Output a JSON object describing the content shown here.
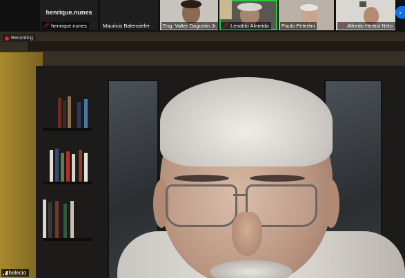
{
  "participants": [
    {
      "id": "henrique",
      "display": "henrique.nunes",
      "label": "henrique.nunes",
      "muted": true
    },
    {
      "id": "mauricio",
      "label": "Mauricio Balensiefer",
      "muted": false
    },
    {
      "id": "valter",
      "label": "Eng. Valter Dagostin Jr.",
      "muted": false
    },
    {
      "id": "lenaldo",
      "label": "Lenaldo Almeida",
      "muted": true
    },
    {
      "id": "paulo",
      "label": "Paulo Peterlini",
      "muted": false
    },
    {
      "id": "alfredo",
      "label": "Alfredo Herbst Neto ...",
      "muted": true
    }
  ],
  "recording": {
    "label": "Recording"
  },
  "self_view": {
    "name": "helecio"
  },
  "icons": {
    "next": "chevron-right-icon",
    "mic_muted": "mic-muted-icon",
    "signal": "signal-bars-icon"
  },
  "colors": {
    "accent": "#0e72ed",
    "muted_mic": "#e23a3a",
    "recording": "#e22222"
  }
}
